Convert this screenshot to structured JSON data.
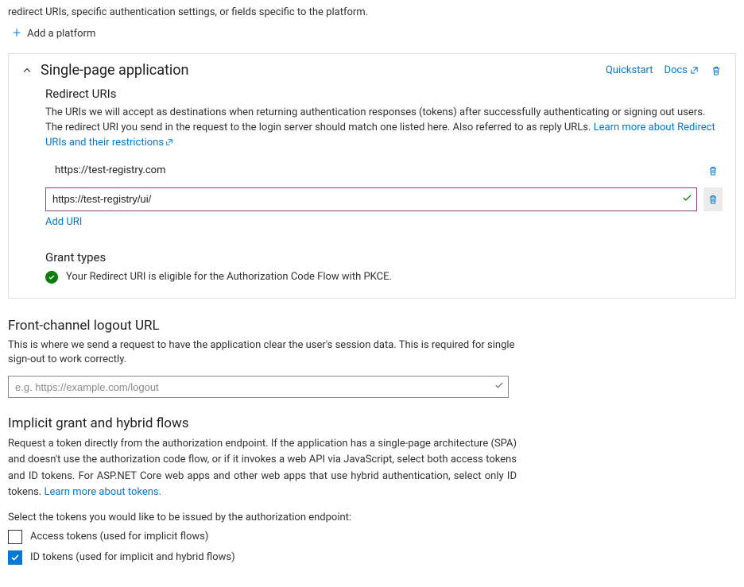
{
  "intro_snippet": "redirect URIs, specific authentication settings, or fields specific to the platform.",
  "add_platform_label": "Add a platform",
  "spa_panel": {
    "title": "Single-page application",
    "quickstart": "Quickstart",
    "docs": "Docs",
    "redirect_uris_heading": "Redirect URIs",
    "redirect_desc_1": "The URIs we will accept as destinations when returning authentication responses (tokens) after successfully authenticating or signing out users. The redirect URI you send in the request to the login server should match one listed here. Also referred to as reply URLs. ",
    "redirect_learn_more": "Learn more about Redirect URIs and their restrictions",
    "uris": {
      "static": "https://test-registry.com",
      "editing_value": "https://test-registry/ui/"
    },
    "add_uri": "Add URI",
    "grant_types_heading": "Grant types",
    "grant_status": "Your Redirect URI is eligible for the Authorization Code Flow with PKCE."
  },
  "front_channel": {
    "title": "Front-channel logout URL",
    "desc": "This is where we send a request to have the application clear the user's session data. This is required for single sign-out to work correctly.",
    "placeholder": "e.g. https://example.com/logout"
  },
  "implicit": {
    "title": "Implicit grant and hybrid flows",
    "desc_1": "Request a token directly from the authorization endpoint. If the application has a single-page architecture (SPA) and doesn't use the authorization code flow, or if it invokes a web API via JavaScript, select both access tokens and ID tokens. For ASP.NET Core web apps and other web apps that use hybrid authentication, select only ID tokens. ",
    "learn_more": "Learn more about tokens.",
    "select_label": "Select the tokens you would like to be issued by the authorization endpoint:",
    "cb_access": "Access tokens (used for implicit flows)",
    "cb_id": "ID tokens (used for implicit and hybrid flows)"
  }
}
